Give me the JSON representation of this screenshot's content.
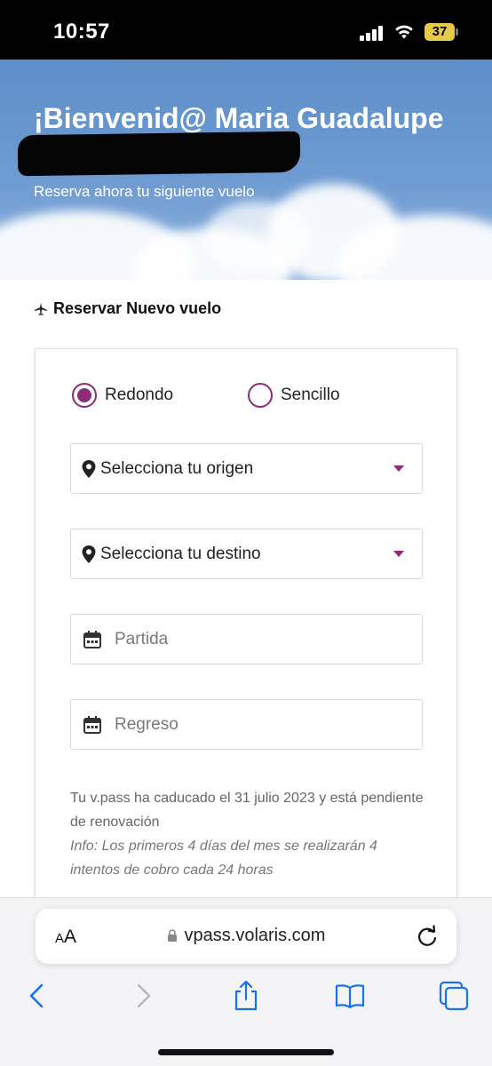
{
  "status_bar": {
    "time": "10:57",
    "battery_level": "37",
    "battery_color": "#e6c94a"
  },
  "hero": {
    "title": "¡Bienvenid@ Maria Guadalupe",
    "subtitle": "Reserva ahora tu siguiente vuelo"
  },
  "section": {
    "header": "Reservar Nuevo vuelo",
    "icon": "plane-icon"
  },
  "trip_type": {
    "options": [
      {
        "label": "Redondo",
        "selected": true
      },
      {
        "label": "Sencillo",
        "selected": false
      }
    ],
    "accent_color": "#8e2b78"
  },
  "fields": {
    "origin": {
      "label": "Selecciona tu origen",
      "icon": "location-pin-icon"
    },
    "destination": {
      "label": "Selecciona tu destino",
      "icon": "location-pin-icon"
    },
    "departure": {
      "placeholder": "Partida",
      "icon": "calendar-icon"
    },
    "return": {
      "placeholder": "Regreso",
      "icon": "calendar-icon"
    }
  },
  "notice": {
    "text": "Tu v.pass ha caducado el 31 julio 2023 y está pendiente de renovación",
    "info": "Info: Los primeros 4 días del mes se realizarán 4 intentos de cobro cada 24 horas"
  },
  "browser": {
    "text_size_label_small": "A",
    "text_size_label_large": "A",
    "url": "vpass.volaris.com",
    "toolbar_color": "#1a73e8"
  }
}
